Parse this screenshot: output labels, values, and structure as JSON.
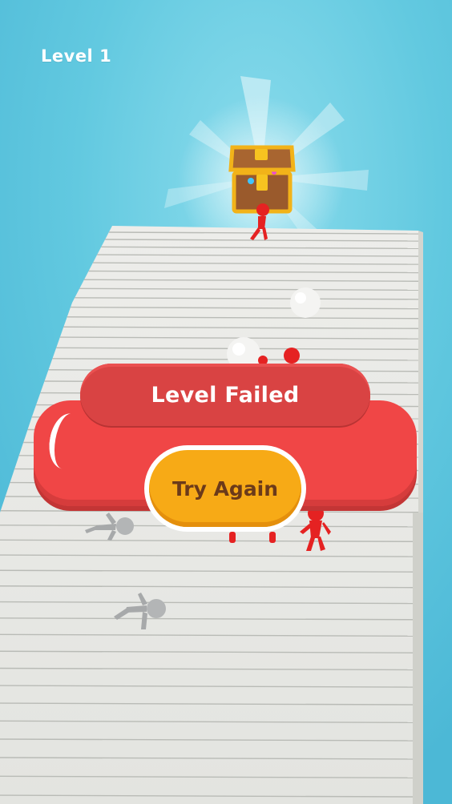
{
  "hud": {
    "level_label": "Level 1"
  },
  "dialog": {
    "title": "Level Failed",
    "button_label": "Try Again"
  },
  "colors": {
    "sky": "#5fc8e0",
    "stairs": "#e9eae4",
    "panel_red": "#f04646",
    "header_red": "#d94343",
    "button_orange": "#f7aa16",
    "button_text": "#6b3a1a",
    "enemy_red": "#e52222",
    "fallen_gray": "#a9abac"
  }
}
